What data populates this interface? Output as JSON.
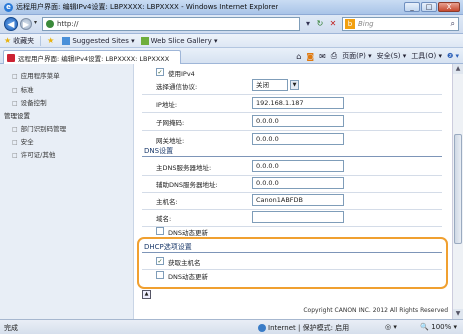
{
  "window": {
    "title": "远程用户界面: 编辑IPv4设置: LBPXXXX: LBPXXXX - Windows Internet Explorer",
    "buttons": {
      "minimize": "_",
      "maximize": "□",
      "close": "X"
    }
  },
  "address_bar": {
    "url": "http://",
    "search_placeholder": "Bing",
    "search_logo": "b"
  },
  "favorites_bar": {
    "favorites_label": "收藏夹",
    "suggested_sites": "Suggested Sites ▾",
    "web_slice_gallery": "Web Slice Gallery ▾"
  },
  "tab": {
    "label": "远程用户界面: 编辑IPv4设置: LBPXXXX: LBPXXXX"
  },
  "command_bar": {
    "page": "页面(P) ▾",
    "safety": "安全(S) ▾",
    "tools": "工具(O) ▾",
    "help": "❷ ▾"
  },
  "left_nav": {
    "items": [
      {
        "label": "应用程序菜单"
      },
      {
        "label": "标准"
      },
      {
        "label": "设备控制"
      }
    ],
    "section_head": "管理设置",
    "sub_items": [
      {
        "label": "部门识别码管理"
      },
      {
        "label": "安全"
      },
      {
        "label": "许可证/其他"
      }
    ]
  },
  "ipv4": {
    "use_ipv4_label": "使用IPv4",
    "use_ipv4_checked": true,
    "protocol_label": "选择通信协议:",
    "protocol_value": "关闭",
    "ip_label": "IP地址:",
    "ip_value": "192.168.1.187",
    "subnet_label": "子网掩码:",
    "subnet_value": "0.0.0.0",
    "gateway_label": "网关地址:",
    "gateway_value": "0.0.0.0"
  },
  "dns": {
    "section_title": "DNS设置",
    "primary_label": "主DNS服务器地址:",
    "primary_value": "0.0.0.0",
    "secondary_label": "辅助DNS服务器地址:",
    "secondary_value": "0.0.0.0",
    "hostname_label": "主机名:",
    "hostname_value": "Canon1ABFDB",
    "domain_label": "域名:",
    "domain_value": "",
    "dynamic_update_label": "DNS动态更新",
    "dynamic_update_checked": false
  },
  "dhcp": {
    "section_title": "DHCP选项设置",
    "acquire_hostname_label": "获取主机名",
    "acquire_hostname_checked": true,
    "dns_dynamic_update_label": "DNS动态更新",
    "dns_dynamic_update_checked": false
  },
  "footer": {
    "copyright": "Copyright CANON INC. 2012 All Rights Reserved",
    "top_icon": "▲"
  },
  "status_bar": {
    "status": "完成",
    "zone": "Internet | 保护模式: 启用",
    "zoom": "100% ▾",
    "zoom_icon": "🔍"
  },
  "colors": {
    "highlight_border": "#f0a030",
    "section_title": "#1b3a6b"
  },
  "icons": {
    "back": "back-arrow-icon",
    "forward": "forward-arrow-icon",
    "refresh": "refresh-icon",
    "stop": "stop-icon",
    "search": "search-icon",
    "home": "home-icon",
    "feeds": "rss-icon",
    "mail": "mail-icon",
    "print": "print-icon"
  }
}
